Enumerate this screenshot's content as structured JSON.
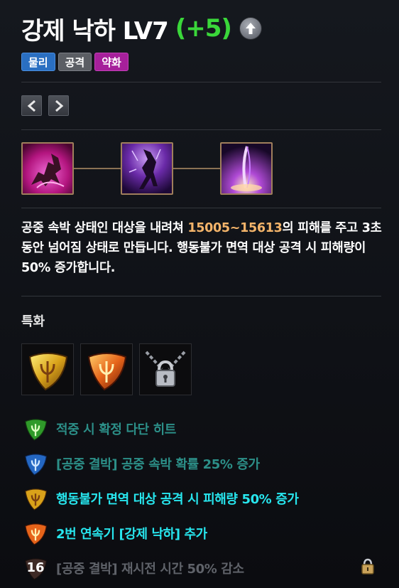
{
  "skill": {
    "title": "강제 낙하 LV7",
    "bonus": "(+5)"
  },
  "tags": [
    "물리",
    "공격",
    "약화"
  ],
  "description": {
    "part1": "공중 속박 상태인 대상을 내려쳐 ",
    "damage": "15005~15613",
    "part2": "의 피해를 주고 3초 동안 넘어짐 상태로 만듭니다. 행동불가 면역 대상 공격 시 피해량이 50% 증가합니다."
  },
  "specialization": {
    "label": "특화",
    "icons": [
      "trident-gold-shield-icon",
      "trident-orange-shield-icon",
      "chained-padlock-icon"
    ],
    "entries": [
      {
        "text": "적중 시 확정 다단 히트",
        "color_key": "teal",
        "icon": "trident-green-shield-icon"
      },
      {
        "text": "[공중 결박] 공중 속박 확률 25% 증가",
        "color_key": "teal",
        "icon": "trident-blue-shield-icon"
      },
      {
        "text": "행동불가 면역 대상 공격 시 피해량 50% 증가",
        "color_key": "cyan",
        "icon": "trident-gold-shield-icon"
      },
      {
        "text": "2번 연속기 [강제 낙하] 추가",
        "color_key": "cyan",
        "icon": "trident-orange-shield-icon"
      },
      {
        "text": "[공중 결박] 재시전 시간 50% 감소",
        "color_key": "grey",
        "icon": "dark-shield-icon",
        "level": "16",
        "locked": true
      }
    ]
  },
  "colors": {
    "bonus": "#3ad73a",
    "damage": "#f3b46a",
    "teal": "#2c8f88",
    "cyan": "#27e6ee",
    "grey": "#5f6269",
    "tag_physical": "#2a6fc2",
    "tag_attack": "#5b5e64",
    "tag_weaken": "#a6209b"
  }
}
